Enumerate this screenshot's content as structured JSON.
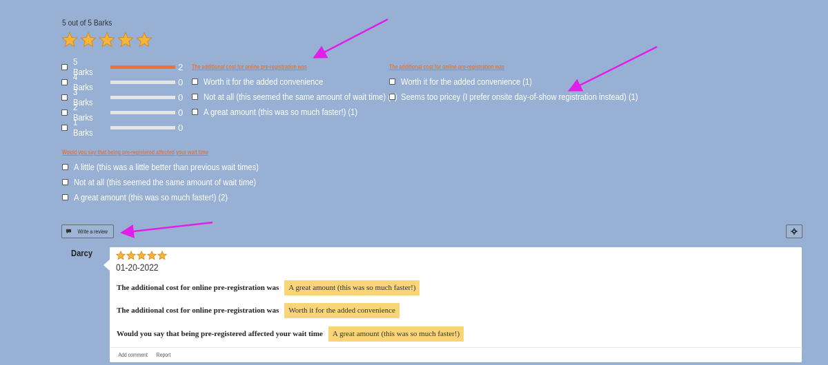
{
  "summary": {
    "rating_text": "5 out of 5 Barks",
    "rating": 5,
    "max_rating": 5
  },
  "distribution": [
    {
      "label": "5 Barks",
      "count": "2",
      "fraction": 1.0
    },
    {
      "label": "4 Barks",
      "count": "0",
      "fraction": 0
    },
    {
      "label": "3 Barks",
      "count": "0",
      "fraction": 0
    },
    {
      "label": "2 Barks",
      "count": "0",
      "fraction": 0
    },
    {
      "label": "1 Barks",
      "count": "0",
      "fraction": 0
    }
  ],
  "questions": [
    {
      "heading": "The additional cost for online pre-registration was",
      "options": [
        "Worth it for the added convenience",
        "Not at all (this seemed the same amount of wait time) (1)",
        "A great amount (this was so much faster!) (1)"
      ]
    },
    {
      "heading": "The additional cost for online pre-registration was",
      "options": [
        "Worth it for the added convenience (1)",
        "Seems too pricey (I prefer onsite day-of-show registration instead) (1)"
      ]
    },
    {
      "heading": "Would you say that being pre-registered affected your wait time",
      "options": [
        "A little (this was a little better than previous wait times)",
        "Not at all (this seemed the same amount of wait time)",
        "A great amount (this was so much faster!) (2)"
      ]
    }
  ],
  "toolbar": {
    "write_review_label": "Write a review",
    "comment_icon": "comment-icon",
    "settings_icon": "gear-icon"
  },
  "review": {
    "author": "Darcy",
    "rating": 5,
    "date": "01-20-2022",
    "answers": [
      {
        "question": "The additional cost for online pre-registration was",
        "answer": "A great amount (this was so much faster!)"
      },
      {
        "question": "The additional cost for online pre-registration was",
        "answer": "Worth it for the added convenience"
      },
      {
        "question": "Would you say that being pre-registered affected your wait time",
        "answer": "A great amount (this was so much faster!)"
      }
    ],
    "actions": {
      "add_comment": "Add comment",
      "report": "Report"
    }
  },
  "colors": {
    "background": "#97b0d3",
    "accent_orange": "#ea733a",
    "answer_highlight": "#f9d479",
    "annotation_arrow": "#e020e8"
  }
}
